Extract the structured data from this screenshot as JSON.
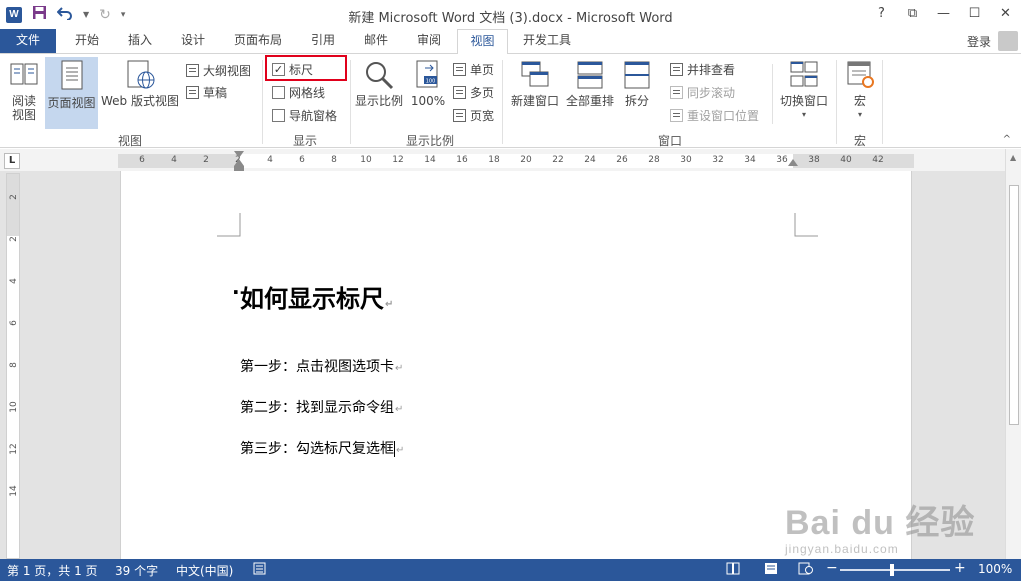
{
  "window": {
    "title": "新建 Microsoft Word 文档 (3).docx - Microsoft Word",
    "controls": [
      "?",
      "⧉",
      "—",
      "☐",
      "✕"
    ]
  },
  "tabs": [
    "文件",
    "开始",
    "插入",
    "设计",
    "页面布局",
    "引用",
    "邮件",
    "审阅",
    "视图",
    "开发工具"
  ],
  "active_tab": "视图",
  "login": "登录",
  "ribbon": {
    "views": {
      "label": "视图",
      "read_mode": "阅读\n视图",
      "print_layout": "页面视图",
      "web_layout": "Web 版式视图",
      "outline": "大纲视图",
      "draft": "草稿"
    },
    "show": {
      "label": "显示",
      "ruler": "标尺",
      "ruler_checked": true,
      "gridlines": "网格线",
      "gridlines_checked": false,
      "nav_pane": "导航窗格",
      "nav_pane_checked": false
    },
    "zoom": {
      "label": "显示比例",
      "zoom": "显示比例",
      "hundred": "100%",
      "one_page": "单页",
      "multi_page": "多页",
      "page_width": "页宽"
    },
    "window": {
      "label": "窗口",
      "new_window": "新建窗口",
      "arrange_all": "全部重排",
      "split": "拆分",
      "side_by_side": "并排查看",
      "sync_scroll": "同步滚动",
      "reset_position": "重设窗口位置",
      "switch_windows": "切换窗口"
    },
    "macros": {
      "label": "宏",
      "macros": "宏"
    }
  },
  "ruler": {
    "tab_selector": "L",
    "h_ticks": [
      "6",
      "4",
      "2",
      "2",
      "4",
      "6",
      "8",
      "10",
      "12",
      "14",
      "16",
      "18",
      "20",
      "22",
      "24",
      "26",
      "28",
      "30",
      "32",
      "34",
      "36",
      "38",
      "40",
      "42"
    ],
    "v_ticks": [
      "2",
      "2",
      "4",
      "6",
      "8",
      "10",
      "12",
      "14"
    ]
  },
  "document": {
    "title": "如何显示标尺",
    "lines": [
      "第一步：点击视图选项卡",
      "第二步：找到显示命令组",
      "第三步：勾选标尺复选框"
    ],
    "para_mark": "↵"
  },
  "watermark": {
    "big": "Bai du 经验",
    "small": "jingyan.baidu.com"
  },
  "status": {
    "page": "第 1 页，共 1 页",
    "words": "39 个字",
    "language": "中文(中国)",
    "zoom": "100%"
  },
  "colors": {
    "accent": "#2b579a",
    "highlight_box": "#e0001b",
    "selected_button": "#c5d7ee"
  }
}
